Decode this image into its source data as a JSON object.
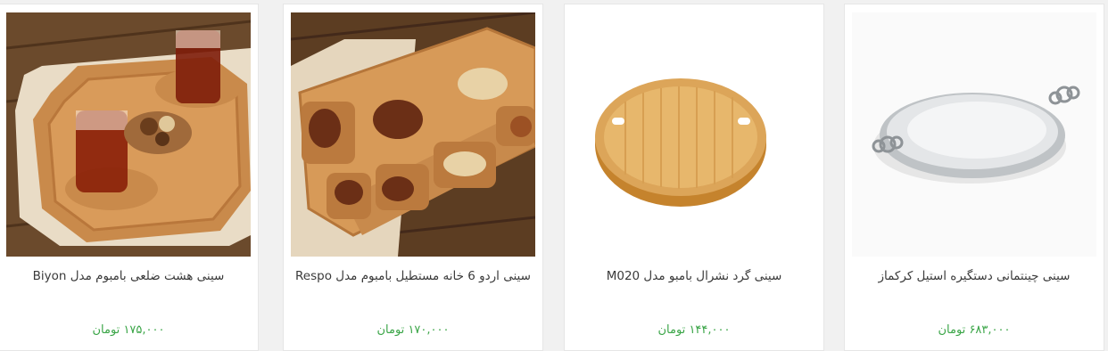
{
  "currency": "تومان",
  "price_color": "#3aa547",
  "products": [
    {
      "title": "سینی هشت ضلعی بامبوم مدل Biyon",
      "price": "۱۷۵,۰۰۰",
      "image": "octagonal-bamboo-tray-with-tea-glasses"
    },
    {
      "title": "سینی اردو 6 خانه مستطیل بامبوم مدل Respo",
      "price": "۱۷۰,۰۰۰",
      "image": "six-compartment-bamboo-tray-with-nuts"
    },
    {
      "title": "سینی گرد نشرال بامبو مدل M020",
      "price": "۱۴۴,۰۰۰",
      "image": "round-bamboo-tray"
    },
    {
      "title": "سینی چینتمانی دستگیره استیل کرکماز",
      "price": "۶۸۳,۰۰۰",
      "image": "oval-steel-tray-with-handles"
    }
  ]
}
